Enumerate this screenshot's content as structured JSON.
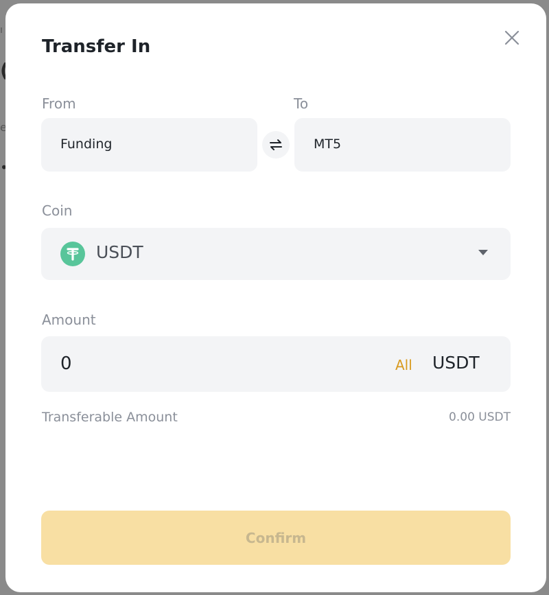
{
  "backdrop": {
    "fragment_1": "ı",
    "fragment_2": "(",
    "fragment_3": "e",
    "fragment_4": "•"
  },
  "modal": {
    "title": "Transfer In",
    "close_icon": "close-icon",
    "from": {
      "label": "From",
      "value": "Funding"
    },
    "to": {
      "label": "To",
      "value": "MT5"
    },
    "swap_icon": "swap-arrows-icon",
    "coin": {
      "label": "Coin",
      "value": "USDT",
      "icon": "tether-icon",
      "icon_color": "#58c59a",
      "dropdown_icon": "caret-down-icon"
    },
    "amount": {
      "label": "Amount",
      "value": "0",
      "all_label": "All",
      "unit": "USDT",
      "all_color": "#d89a1f"
    },
    "transferable": {
      "label": "Transferable Amount",
      "value": "0.00 USDT"
    },
    "confirm_label": "Confirm",
    "confirm_color": "#f8dfa3"
  }
}
